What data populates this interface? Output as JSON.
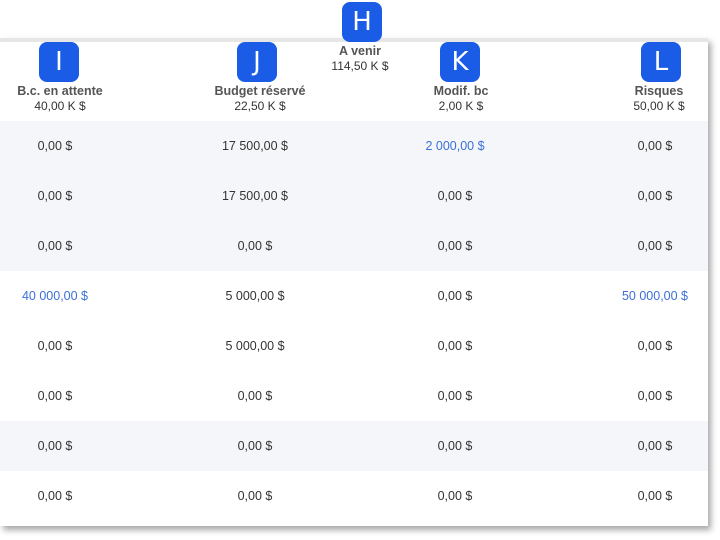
{
  "badges": {
    "h": "H",
    "i": "I",
    "j": "J",
    "k": "K",
    "l": "L"
  },
  "group": {
    "title": "A venir",
    "total": "114,50 K $"
  },
  "columns": [
    {
      "title": "B.c. en attente",
      "total": "40,00 K $"
    },
    {
      "title": "Budget réservé",
      "total": "22,50 K $"
    },
    {
      "title": "Modif. bc",
      "total": "2,00 K $"
    },
    {
      "title": "Risques",
      "total": "50,00 K $"
    }
  ],
  "rows": [
    [
      "0,00 $",
      "17 500,00 $",
      "2 000,00 $",
      "0,00 $"
    ],
    [
      "0,00 $",
      "17 500,00 $",
      "0,00 $",
      "0,00 $"
    ],
    [
      "0,00 $",
      "0,00 $",
      "0,00 $",
      "0,00 $"
    ],
    [
      "40 000,00 $",
      "5 000,00 $",
      "0,00 $",
      "50 000,00 $"
    ],
    [
      "0,00 $",
      "5 000,00 $",
      "0,00 $",
      "0,00 $"
    ],
    [
      "0,00 $",
      "0,00 $",
      "0,00 $",
      "0,00 $"
    ],
    [
      "0,00 $",
      "0,00 $",
      "0,00 $",
      "0,00 $"
    ],
    [
      "0,00 $",
      "0,00 $",
      "0,00 $",
      "0,00 $"
    ]
  ],
  "link_color": "#3b6fd8",
  "badge_color": "#1a5ce6"
}
